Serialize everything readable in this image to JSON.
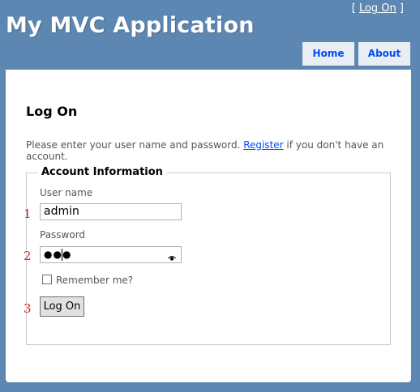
{
  "header": {
    "app_title": "My MVC Application",
    "login_prefix": "[ ",
    "login_link": "Log On",
    "login_suffix": " ]"
  },
  "nav": {
    "tabs": [
      {
        "label": "Home"
      },
      {
        "label": "About"
      }
    ]
  },
  "main": {
    "title": "Log On",
    "intro_before": "Please enter your user name and password. ",
    "register_link": "Register",
    "intro_after": " if you don't have an account.",
    "fieldset": {
      "legend": "Account Information",
      "username_label": "User name",
      "username_value": "admin",
      "password_label": "Password",
      "password_masked": "●●●",
      "remember_label": "Remember me?",
      "remember_checked": false,
      "submit_label": "Log On"
    }
  },
  "annotations": {
    "markers": [
      "1",
      "2",
      "3"
    ],
    "color": "#e02020"
  },
  "colors": {
    "page_background": "#5c87b2",
    "tab_background": "#e8eef4",
    "link": "#034af3"
  }
}
